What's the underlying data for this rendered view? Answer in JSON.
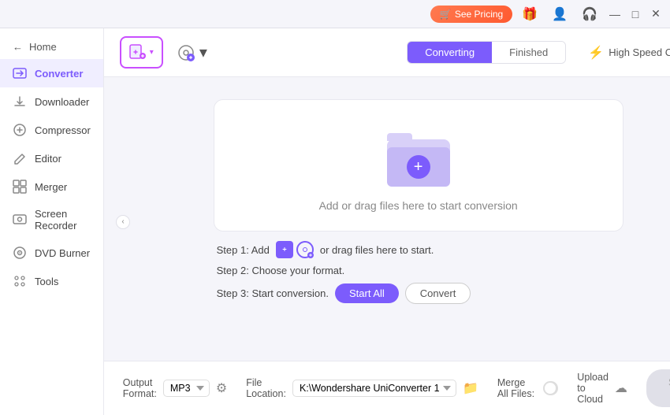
{
  "titlebar": {
    "see_pricing_label": "See Pricing",
    "controls": {
      "minimize": "—",
      "maximize": "□",
      "close": "✕"
    }
  },
  "sidebar": {
    "back_label": "Home",
    "items": [
      {
        "id": "converter",
        "label": "Converter",
        "icon": "⇄",
        "active": true
      },
      {
        "id": "downloader",
        "label": "Downloader",
        "icon": "↓"
      },
      {
        "id": "compressor",
        "label": "Compressor",
        "icon": "⊕"
      },
      {
        "id": "editor",
        "label": "Editor",
        "icon": "✂"
      },
      {
        "id": "merger",
        "label": "Merger",
        "icon": "⊞"
      },
      {
        "id": "screen-recorder",
        "label": "Screen Recorder",
        "icon": "◉"
      },
      {
        "id": "dvd-burner",
        "label": "DVD Burner",
        "icon": "◎"
      },
      {
        "id": "tools",
        "label": "Tools",
        "icon": "⚙"
      }
    ]
  },
  "toolbar": {
    "add_file_label": "",
    "converting_tab": "Converting",
    "finished_tab": "Finished",
    "high_speed_label": "High Speed Conversion"
  },
  "drop_zone": {
    "text": "Add or drag files here to start conversion"
  },
  "steps": {
    "step1_prefix": "Step 1: Add",
    "step1_suffix": "or drag files here to start.",
    "step2": "Step 2: Choose your format.",
    "step3_prefix": "Step 3: Start conversion.",
    "start_all_label": "Start All",
    "convert_label": "Convert"
  },
  "bottom_bar": {
    "output_format_label": "Output Format:",
    "output_format_value": "MP3",
    "file_location_label": "File Location:",
    "file_location_value": "K:\\Wondershare UniConverter 1",
    "merge_all_label": "Merge All Files:",
    "upload_to_cloud_label": "Upload to Cloud",
    "start_all_label": "Start All"
  }
}
